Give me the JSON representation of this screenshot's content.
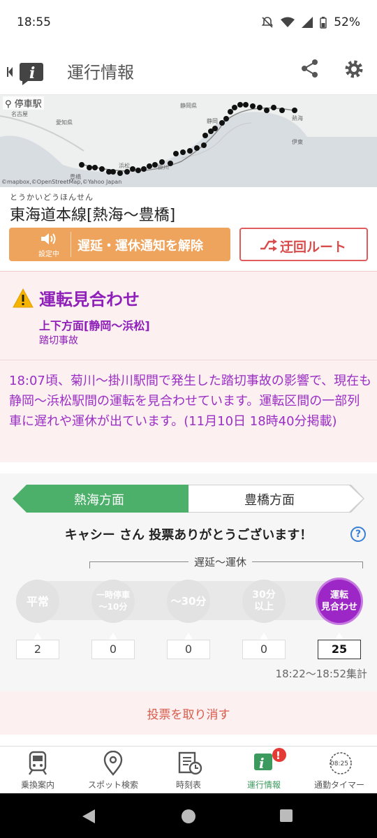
{
  "status_bar": {
    "time": "18:55",
    "battery": "52%"
  },
  "app_bar": {
    "title": "運行情報"
  },
  "map": {
    "station_label": "停車駅",
    "credit": "©mapbox,©OpenStreetMap,©Yahoo Japan",
    "place_names": [
      "名古屋",
      "愛知県",
      "静岡県",
      "静岡",
      "浜松",
      "掛川",
      "熱海",
      "伊東",
      "豊橋"
    ]
  },
  "line": {
    "ruby": "とうかいどうほんせん",
    "name": "東海道本線[熱海〜豊橋]"
  },
  "buttons": {
    "notify_sub": "設定中",
    "notify_label": "遅延・運休通知を解除",
    "detour_label": "迂回ルート"
  },
  "alert": {
    "status": "運転見合わせ",
    "direction": "上下方面[静岡〜浜松]",
    "cause": "踏切事故",
    "message": "18:07頃、菊川〜掛川駅間で発生した踏切事故の影響で、現在も静岡〜浜松駅間の運転を見合わせています。運転区間の一部列車に遅れや運休が出ています。(11月10日 18時40分掲載)"
  },
  "vote": {
    "tabs": [
      "熱海方面",
      "豊橋方面"
    ],
    "thanks": "キャシー さん 投票ありがとうございます！",
    "help": "?",
    "range_label": "遅延〜運休",
    "options": [
      {
        "label": "平常",
        "count": "2"
      },
      {
        "label": "一時停車\n〜10分",
        "count": "0"
      },
      {
        "label": "〜30分",
        "count": "0"
      },
      {
        "label": "30分\n以上",
        "count": "0"
      },
      {
        "label": "運転\n見合わせ",
        "count": "25"
      }
    ],
    "selected_index": 4,
    "period": "18:22〜18:52集計",
    "cancel": "投票を取り消す"
  },
  "bottom_nav": [
    {
      "label": "乗換案内",
      "icon": "train-icon"
    },
    {
      "label": "スポット検索",
      "icon": "pin-icon"
    },
    {
      "label": "時刻表",
      "icon": "timetable-icon"
    },
    {
      "label": "運行情報",
      "icon": "info-icon",
      "active": true,
      "badge": "!"
    },
    {
      "label": "通勤タイマー",
      "icon": "timer-icon",
      "timer_text": "08:25"
    }
  ],
  "colors": {
    "accent_green": "#4caf6a",
    "status_purple": "#8e1fb8",
    "notify_orange": "#eea45c",
    "detour_red": "#e05b5b",
    "vote_selected": "#9c27c6"
  }
}
